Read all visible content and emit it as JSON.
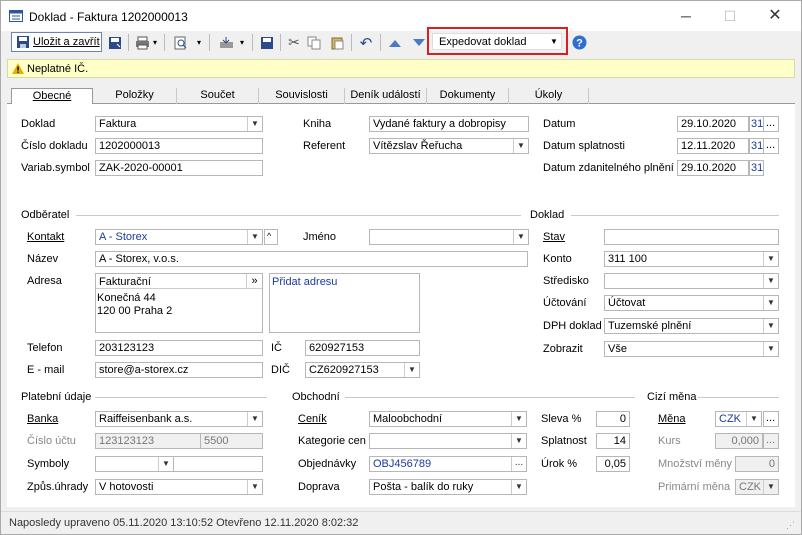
{
  "window": {
    "title": "Doklad - Faktura 1202000013"
  },
  "toolbar": {
    "save_close": "Uložit a zavřít",
    "expedite": "Expedovat doklad"
  },
  "warning": "Neplatné IČ.",
  "tabs": [
    "Obecné",
    "Položky",
    "Součet",
    "Souvislosti",
    "Deník událostí",
    "Dokumenty",
    "Úkoly"
  ],
  "general": {
    "doklad_label": "Doklad",
    "doklad": "Faktura",
    "cislo_label": "Číslo dokladu",
    "cislo": "1202000013",
    "varsym_label": "Variab.symbol",
    "varsym": "ZAK-2020-00001",
    "kniha_label": "Kniha",
    "kniha": "Vydané faktury a dobropisy",
    "referent_label": "Referent",
    "referent": "Vítězslav Řeřucha",
    "datum_label": "Datum",
    "datum": "29.10.2020",
    "splat_label": "Datum splatnosti",
    "splat": "12.11.2020",
    "duzp_label": "Datum zdanitelného plnění",
    "duzp": "29.10.2020",
    "cal": "31"
  },
  "odberatel": {
    "section": "Odběratel",
    "kontakt_label": "Kontakt",
    "kontakt": "A - Storex",
    "jmeno_label": "Jméno",
    "jmeno": "",
    "nazev_label": "Název",
    "nazev": "A - Storex, v.o.s.",
    "adresa_label": "Adresa",
    "adresa_type": "Fakturační",
    "adresa_btn": "»",
    "adresa_line1": "Konečná 44",
    "adresa_line2": "120 00 Praha 2",
    "pridat_adresu": "Přidat adresu",
    "telefon_label": "Telefon",
    "telefon": "203123123",
    "ic_label": "IČ",
    "ic": "620927153",
    "email_label": "E - mail",
    "email": "store@a-storex.cz",
    "dic_label": "DIČ",
    "dic": "CZ620927153"
  },
  "doklad_sect": {
    "section": "Doklad",
    "stav_label": "Stav",
    "stav": "",
    "konto_label": "Konto",
    "konto": "311 100",
    "stredisko_label": "Středisko",
    "stredisko": "",
    "uctovani_label": "Účtování",
    "uctovani": "Účtovat",
    "dph_label": "DPH doklad",
    "dph": "Tuzemské plnění",
    "zobrazit_label": "Zobrazit",
    "zobrazit": "Vše"
  },
  "platebni": {
    "section": "Platební údaje",
    "banka_label": "Banka",
    "banka": "Raiffeisenbank a.s.",
    "ucet_label": "Číslo účtu",
    "ucet": "123123123",
    "kod": "5500",
    "symboly_label": "Symboly",
    "symboly": "",
    "zpusob_label": "Způs.úhrady",
    "zpusob": "V hotovosti"
  },
  "obchodni": {
    "section": "Obchodní",
    "cenik_label": "Ceník",
    "cenik": "Maloobchodní",
    "kategorie_label": "Kategorie cen",
    "kategorie": "",
    "objednavky_label": "Objednávky",
    "objednavky": "OBJ456789",
    "doprava_label": "Doprava",
    "doprava": "Pošta - balík do ruky",
    "sleva_label": "Sleva %",
    "sleva": "0",
    "splatnost_label": "Splatnost",
    "splatnost": "14",
    "urok_label": "Úrok %",
    "urok": "0,05"
  },
  "cizi": {
    "section": "Cizí měna",
    "mena_label": "Měna",
    "mena": "CZK",
    "kurs_label": "Kurs",
    "kurs": "0,000",
    "mnozstvi_label": "Množství měny",
    "mnozstvi": "0",
    "primarni_label": "Primární měna",
    "primarni": "CZK"
  },
  "status": "Naposledy upraveno 05.11.2020 13:10:52 Otevřeno 12.11.2020 8:02:32"
}
